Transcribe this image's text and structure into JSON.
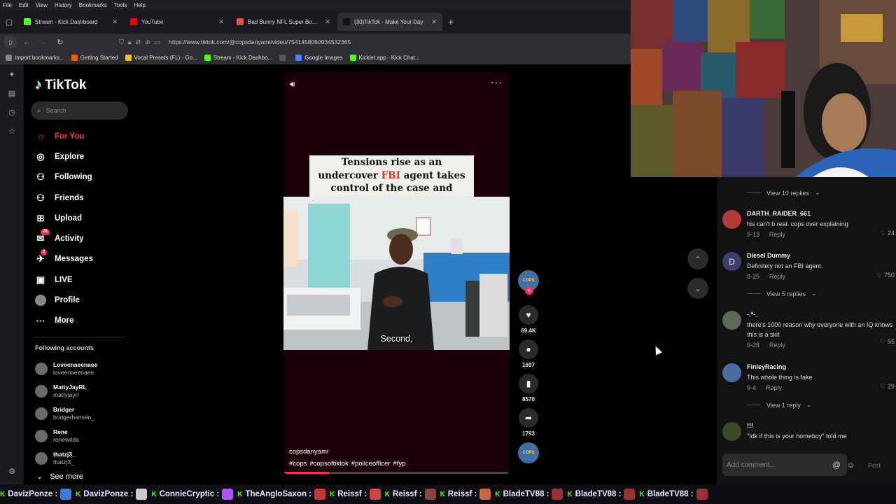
{
  "browser": {
    "menu": [
      "File",
      "Edit",
      "View",
      "History",
      "Bookmarks",
      "Tools",
      "Help"
    ],
    "tabs": [
      {
        "label": "Stream - Kick Dashboard",
        "color": "#53fc18",
        "active": false
      },
      {
        "label": "YouTube",
        "color": "#ff0000",
        "active": false
      },
      {
        "label": "Bad Bunny NFL Super Bowl halft",
        "color": "#d9534f",
        "active": false
      },
      {
        "label": "(30)TikTok - Make Your Day",
        "color": "#111111",
        "active": true
      }
    ],
    "url": "https://www.tiktok.com/@copsdanyami/video/7541458060934532365",
    "bookmarks": [
      {
        "label": "Import bookmarks...",
        "color": "#888888"
      },
      {
        "label": "Getting Started",
        "color": "#e66000"
      },
      {
        "label": "Vocal Presets (FL) - Go...",
        "color": "#f0c419"
      },
      {
        "label": "Stream - Kick Dashbo...",
        "color": "#53fc18"
      },
      {
        "label": "",
        "color": "#555555"
      },
      {
        "label": "Google Images",
        "color": "#4285f4"
      },
      {
        "label": "Kicklet.app - Kick Chat...",
        "color": "#53fc18"
      }
    ]
  },
  "tiktok": {
    "logo": "TikTok",
    "search_placeholder": "Search",
    "nav": [
      {
        "label": "For You",
        "icon": "home-icon",
        "glyph": "⌂",
        "active": true,
        "badge": ""
      },
      {
        "label": "Explore",
        "icon": "compass-icon",
        "glyph": "◎",
        "active": false,
        "badge": ""
      },
      {
        "label": "Following",
        "icon": "following-icon",
        "glyph": "⚇",
        "active": false,
        "badge": ""
      },
      {
        "label": "Friends",
        "icon": "friends-icon",
        "glyph": "⚇",
        "active": false,
        "badge": ""
      },
      {
        "label": "Upload",
        "icon": "upload-icon",
        "glyph": "⊞",
        "active": false,
        "badge": ""
      },
      {
        "label": "Activity",
        "icon": "activity-icon",
        "glyph": "✉",
        "active": false,
        "badge": "28"
      },
      {
        "label": "Messages",
        "icon": "messages-icon",
        "glyph": "✈",
        "active": false,
        "badge": "2"
      },
      {
        "label": "LIVE",
        "icon": "live-icon",
        "glyph": "▣",
        "active": false,
        "badge": ""
      },
      {
        "label": "Profile",
        "icon": "profile-icon",
        "glyph": "●",
        "active": false,
        "badge": ""
      },
      {
        "label": "More",
        "icon": "more-icon",
        "glyph": "···",
        "active": false,
        "badge": ""
      }
    ],
    "following_title": "Following accounts",
    "following": [
      {
        "name": "Loveenaeenaee",
        "user": "loveenaeenaee"
      },
      {
        "name": "MattyJayRL",
        "user": "mattyjayrl"
      },
      {
        "name": "Bridger",
        "user": "bridgerhansen_"
      },
      {
        "name": "Rene",
        "user": "renewitda"
      },
      {
        "name": "thatzj3_",
        "user": "thatzj3_"
      }
    ],
    "see_more": "See more"
  },
  "video": {
    "caption_pre": "Tensions rise as an undercover",
    "caption_red": "FBI",
    "caption_post": "agent takes control of the case and orders a cop out.",
    "subtitle": "Second,",
    "author": "copsdanyami",
    "tags": [
      "#cops",
      "#copsoftiktok",
      "#policeofficer",
      "#fyp"
    ],
    "progress": 0.2,
    "likes": "69.4K",
    "comments": "1697",
    "saves": "8570",
    "shares": "1793",
    "creator_badge": "COPS"
  },
  "comments": {
    "items": [
      {
        "name": "DARTH_RAIDER_661",
        "text": "his can't b real. cops over explaining",
        "date": "9-13",
        "likes": "24",
        "avatar_color": "#b33a3a",
        "initial": ""
      },
      {
        "name": "Diesel Dummy",
        "text": "Definitely not an FBI agent.",
        "date": "8-25",
        "likes": "750",
        "avatar_color": "#3a3f6b",
        "initial": "D"
      },
      {
        "name": "-.*-_",
        "text": "there's 1000 reason why everyone with an IQ knows this is a skit",
        "date": "9-28",
        "likes": "55",
        "avatar_color": "#5e6a55",
        "initial": ""
      },
      {
        "name": "FinleyRacing",
        "text": "This whole thing is fake",
        "date": "9-4",
        "likes": "29",
        "avatar_color": "#4a6da3",
        "initial": ""
      },
      {
        "name": "!!!",
        "text": "\"Idk if this is your homeboy\" told me",
        "date": "",
        "likes": "",
        "avatar_color": "#3a4a2a",
        "initial": ""
      }
    ],
    "reply_label": "Reply",
    "view_replies": [
      "View 10 replies",
      "View 5 replies",
      "View 1 reply"
    ],
    "add_placeholder": "Add comment...",
    "post_label": "Post"
  },
  "ticker": [
    {
      "name": "DavizPonze :",
      "emote": "#3a7bd5"
    },
    {
      "name": "DavizPonze :",
      "emote": "#cccccc"
    },
    {
      "name": "ConnieCryptic :",
      "emote": "#aa55ff"
    },
    {
      "name": "TheAngloSaxon :",
      "emote": "#cc3333"
    },
    {
      "name": "Reissf :",
      "emote": "#cc4444"
    },
    {
      "name": "Reissf :",
      "emote": "#884444"
    },
    {
      "name": "Reissf :",
      "emote": "#cc6644"
    },
    {
      "name": "BladeTV88 :",
      "emote": "#993333"
    },
    {
      "name": "BladeTV88 :",
      "emote": "#993333"
    },
    {
      "name": "BladeTV88 :",
      "emote": "#993333"
    }
  ]
}
